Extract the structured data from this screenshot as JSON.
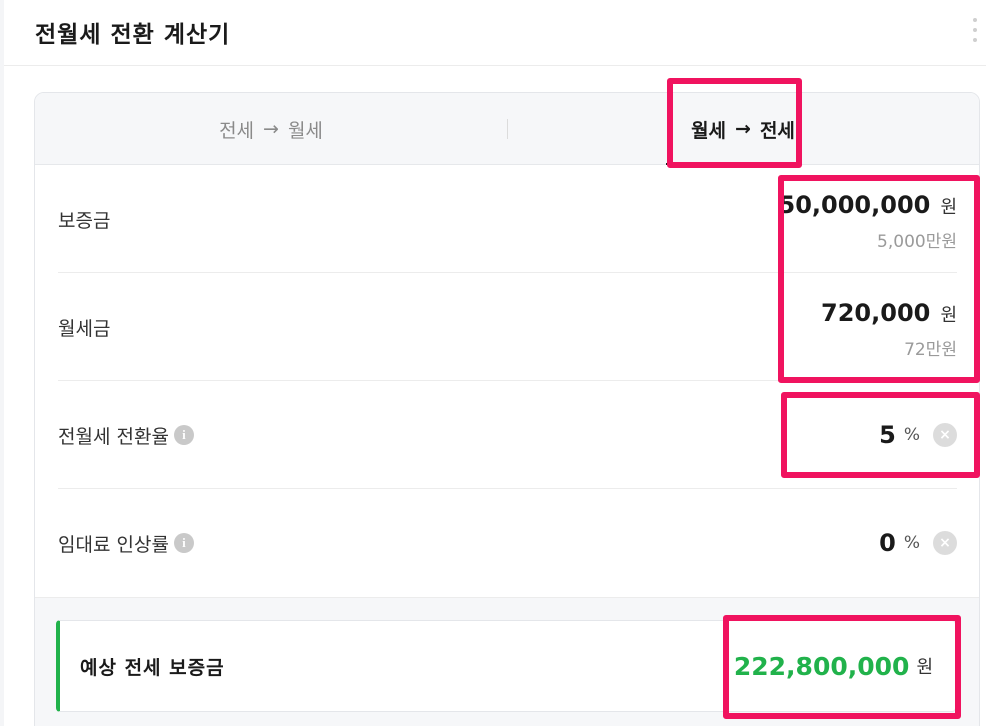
{
  "header": {
    "title": "전월세 전환 계산기"
  },
  "tabs": [
    {
      "from": "전세",
      "arrow": "→",
      "to": "월세"
    },
    {
      "from": "월세",
      "arrow": "→",
      "to": "전세"
    }
  ],
  "rows": {
    "deposit": {
      "label": "보증금",
      "value": "50,000,000",
      "unit": "원",
      "sub": "5,000만원"
    },
    "monthly": {
      "label": "월세금",
      "value": "720,000",
      "unit": "원",
      "sub": "72만원"
    },
    "conversion_rate": {
      "label": "전월세 전환율",
      "value": "5",
      "unit": "%",
      "info_icon": "i",
      "clear_icon": "×"
    },
    "rent_increase": {
      "label": "임대료 인상률",
      "value": "0",
      "unit": "%",
      "info_icon": "i",
      "clear_icon": "×"
    }
  },
  "result": {
    "label": "예상 전세 보증금",
    "value": "222,800,000",
    "unit": "원"
  },
  "colors": {
    "accent_green": "#21b24b",
    "highlight": "#f0135f"
  }
}
